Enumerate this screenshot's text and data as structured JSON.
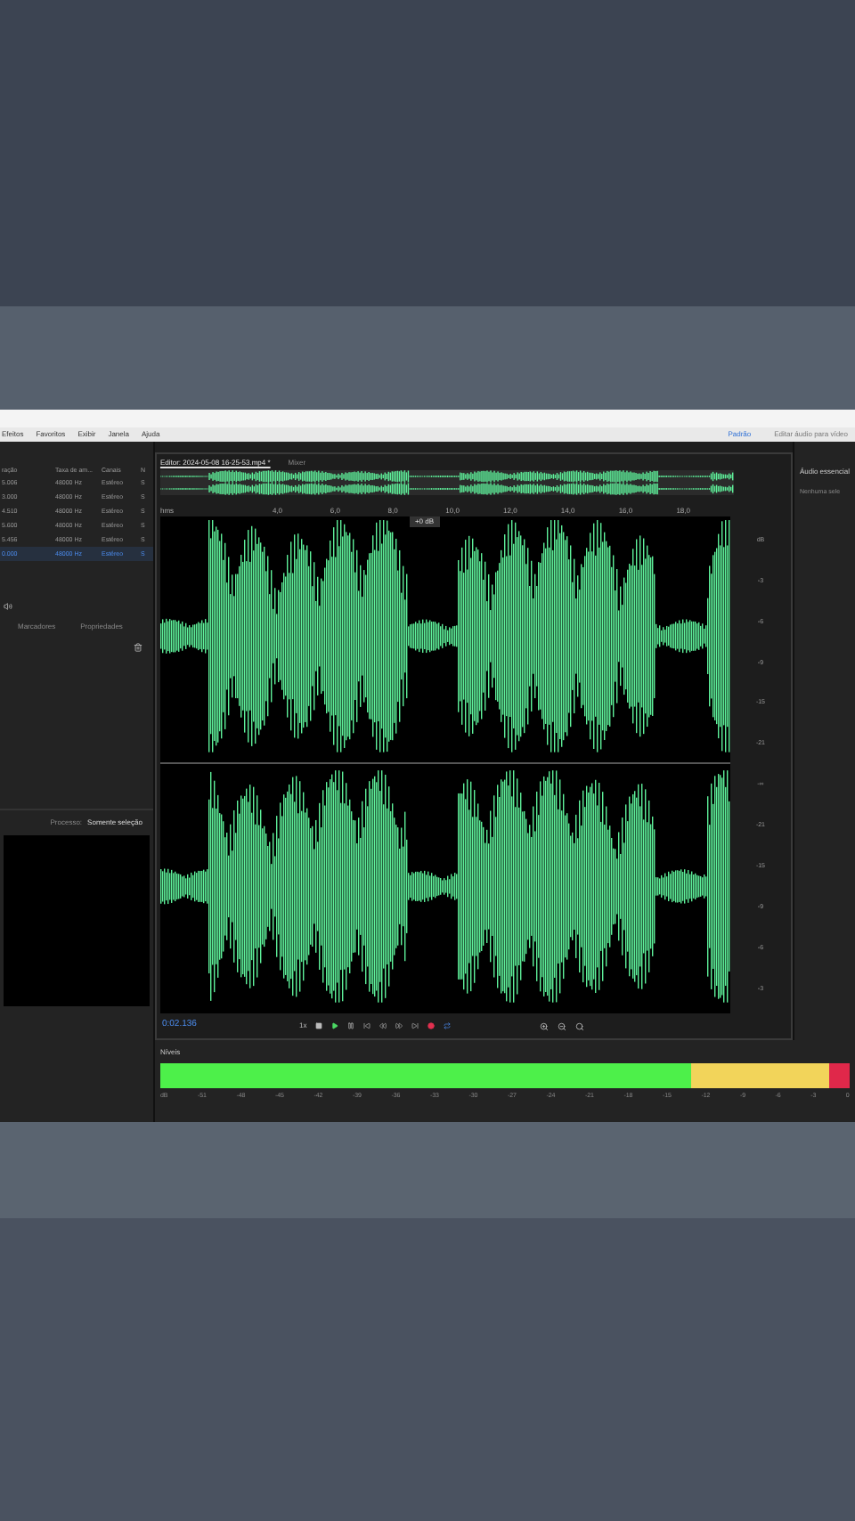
{
  "menu": [
    "Efeitos",
    "Favoritos",
    "Exibir",
    "Janela",
    "Ajuda"
  ],
  "workspace": {
    "items": [
      {
        "label": "Padrão",
        "selected": true
      },
      {
        "label": "Editar áudio para vídeo",
        "selected": false
      }
    ]
  },
  "files": {
    "columns": [
      "ração",
      "Taxa de am...",
      "Canais",
      "N"
    ],
    "rows": [
      {
        "cells": [
          "5.006",
          "48000 Hz",
          "Estéreo",
          "S"
        ],
        "selected": false
      },
      {
        "cells": [
          "3.000",
          "48000 Hz",
          "Estéreo",
          "S"
        ],
        "selected": false
      },
      {
        "cells": [
          "4.510",
          "48000 Hz",
          "Estéreo",
          "S"
        ],
        "selected": false
      },
      {
        "cells": [
          "5.600",
          "48000 Hz",
          "Estéreo",
          "S"
        ],
        "selected": false
      },
      {
        "cells": [
          "5.456",
          "48000 Hz",
          "Estéreo",
          "S"
        ],
        "selected": false
      },
      {
        "cells": [
          "0.000",
          "48000 Hz",
          "Estéreo",
          "S"
        ],
        "selected": true
      }
    ]
  },
  "panel_tabs": [
    {
      "label": "Marcadores",
      "selected": false
    },
    {
      "label": "Propriedades",
      "selected": false
    }
  ],
  "process": {
    "label": "Processo:",
    "value": "Somente seleção"
  },
  "editor": {
    "tabs": [
      {
        "label": "Editor: 2024-05-08 16-25-53.mp4 *",
        "selected": true
      },
      {
        "label": "Mixer",
        "selected": false
      }
    ],
    "ruler": [
      "hms",
      "4,0",
      "6,0",
      "8,0",
      "10,0",
      "12,0",
      "14,0",
      "16,0",
      "18,0"
    ],
    "hud": "+0 dB",
    "db_scale": [
      "dB",
      "-3",
      "-6",
      "-9",
      "-15",
      "-21",
      "-∞",
      "-21",
      "-15",
      "-9",
      "-6",
      "-3"
    ],
    "time": "0:02.136",
    "speed": "1x"
  },
  "levels": {
    "title": "Níveis",
    "level": 1,
    "ticks": [
      "dB",
      "-51",
      "-48",
      "-45",
      "-42",
      "-39",
      "-36",
      "-33",
      "-30",
      "-27",
      "-24",
      "-21",
      "-18",
      "-15",
      "-12",
      "-9",
      "-6",
      "-3",
      "0"
    ]
  },
  "right_panel": {
    "title": "Áudio essencial",
    "subtitle": "Nenhuma sele"
  }
}
